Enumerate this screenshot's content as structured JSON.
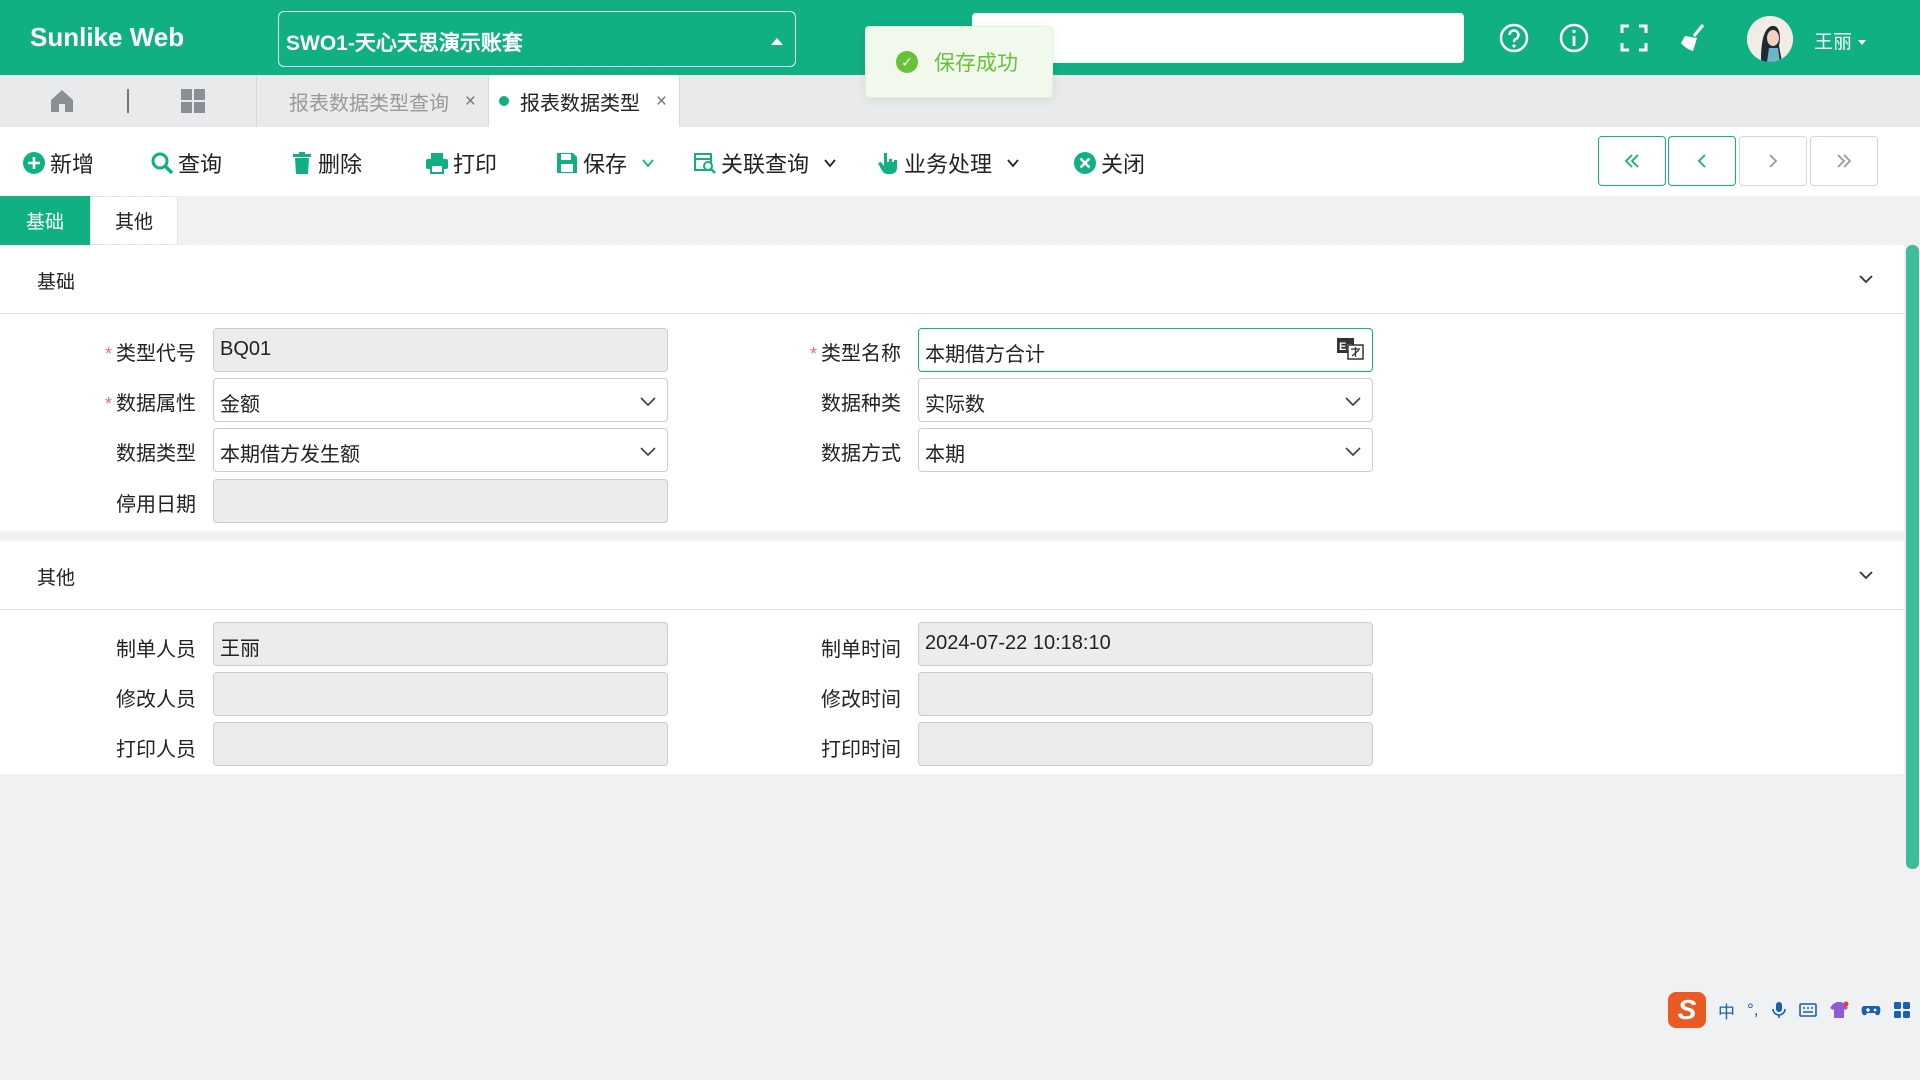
{
  "header": {
    "logo": "Sunlike Web",
    "account": "SWO1-天心天思演示账套",
    "search_placeholder": "",
    "user_name": "王丽"
  },
  "toast": {
    "message": "保存成功"
  },
  "tabs": {
    "items": [
      {
        "label": "报表数据类型查询",
        "active": false
      },
      {
        "label": "报表数据类型",
        "active": true
      }
    ],
    "close_glyph": "×"
  },
  "toolbar": {
    "new": "新增",
    "query": "查询",
    "delete": "删除",
    "print": "打印",
    "save": "保存",
    "related_query": "关联查询",
    "business": "业务处理",
    "close": "关闭"
  },
  "section_tabs": {
    "basic": "基础",
    "other": "其他"
  },
  "basic_panel": {
    "title": "基础",
    "type_code_label": "类型代号",
    "type_code": "BQ01",
    "type_name_label": "类型名称",
    "type_name": "本期借方合计",
    "data_attr_label": "数据属性",
    "data_attr": "金额",
    "data_kind_label": "数据种类",
    "data_kind": "实际数",
    "data_type_label": "数据类型",
    "data_type": "本期借方发生额",
    "data_mode_label": "数据方式",
    "data_mode": "本期",
    "stop_date_label": "停用日期",
    "stop_date": ""
  },
  "other_panel": {
    "title": "其他",
    "creator_label": "制单人员",
    "creator": "王丽",
    "create_time_label": "制单时间",
    "create_time": "2024-07-22 10:18:10",
    "modifier_label": "修改人员",
    "modifier": "",
    "modify_time_label": "修改时间",
    "modify_time": "",
    "printer_label": "打印人员",
    "printer": "",
    "print_time_label": "打印时间",
    "print_time": ""
  },
  "required_mark": "*",
  "ime": {
    "s": "S",
    "mode": "中",
    "punct": "°,",
    "lang_icon_text": "En"
  },
  "colors": {
    "brand": "#10b083",
    "toast_green": "#67c23a",
    "required": "#f56c6c"
  }
}
